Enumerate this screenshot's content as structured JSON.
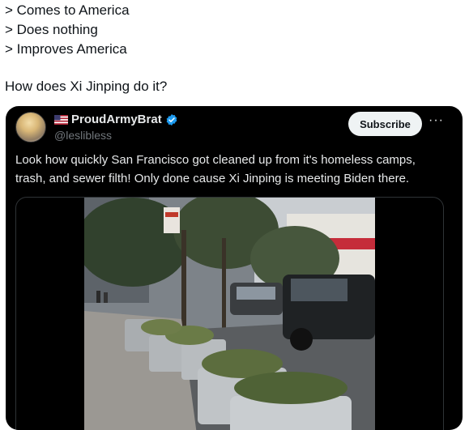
{
  "post": {
    "lines": [
      "> Comes to America",
      "> Does nothing",
      "> Improves America"
    ],
    "question": "How does Xi Jinping do it?"
  },
  "quoted": {
    "display_name": "ProudArmyBrat",
    "handle": "@leslibless",
    "subscribe_label": "Subscribe",
    "more_label": "···",
    "text": "Look how quickly San Francisco got cleaned up from it's homeless camps, trash, and sewer filth! Only done cause Xi Jinping is meeting Biden there.",
    "icons": {
      "flag": "us-flag-icon",
      "verified": "verified-badge-icon",
      "more": "more-icon"
    }
  },
  "colors": {
    "verified": "#1d9bf0",
    "card_bg": "#000000",
    "subscribe_bg": "#eff3f4"
  }
}
